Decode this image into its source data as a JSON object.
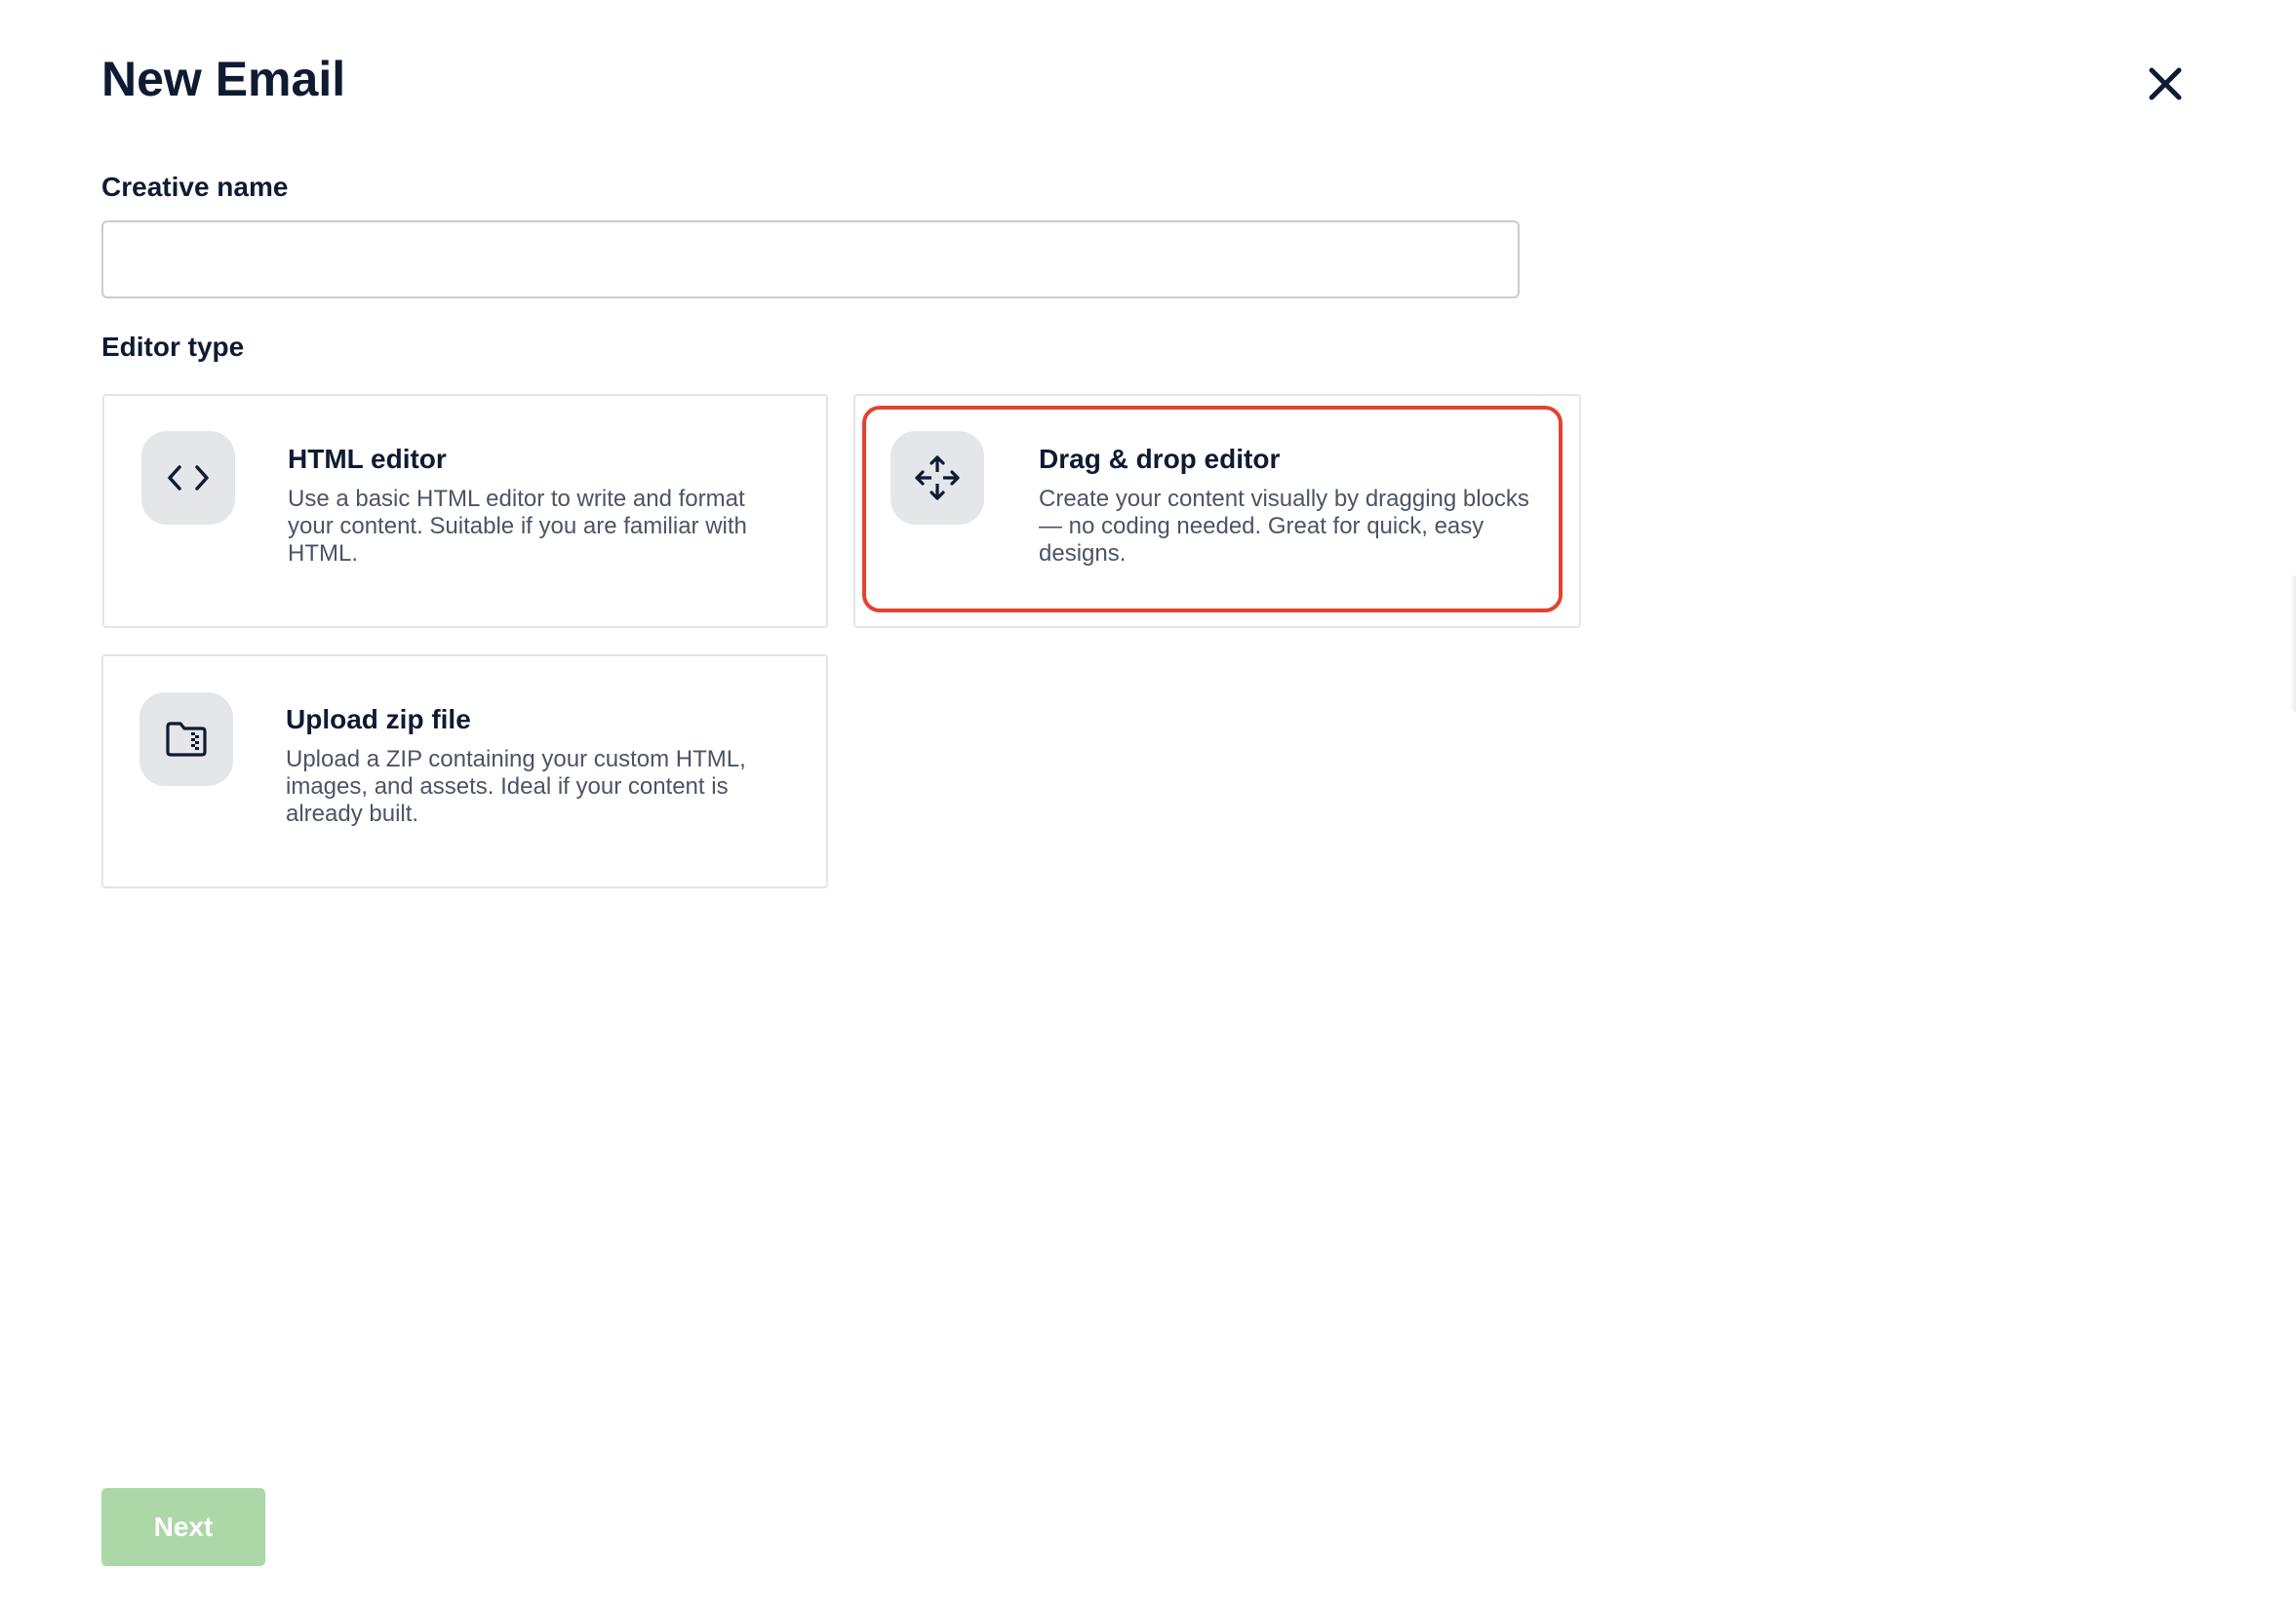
{
  "header": {
    "title": "New Email",
    "close_icon": "close-icon"
  },
  "form": {
    "creative_name_label": "Creative name",
    "creative_name_value": "",
    "creative_name_placeholder": "",
    "editor_type_label": "Editor type"
  },
  "editor_options": [
    {
      "title": "HTML editor",
      "description": "Use a basic HTML editor to write and format your content. Suitable if you are familiar with HTML.",
      "icon": "code-icon"
    },
    {
      "title": "Drag & drop editor",
      "description": "Create your content visually by dragging blocks — no coding needed. Great for quick, easy designs.",
      "icon": "move-arrows-icon",
      "highlighted": true
    },
    {
      "title": "Upload zip file",
      "description": "Upload a ZIP containing your custom HTML, images, and assets. Ideal if your content is already built.",
      "icon": "zip-folder-icon"
    }
  ],
  "footer": {
    "next_label": "Next"
  },
  "colors": {
    "text_primary": "#0f1b33",
    "text_secondary": "#4b5466",
    "icon_tile_bg": "#e4e6ea",
    "highlight": "#e2432f",
    "next_button_bg": "#acd7a6"
  }
}
